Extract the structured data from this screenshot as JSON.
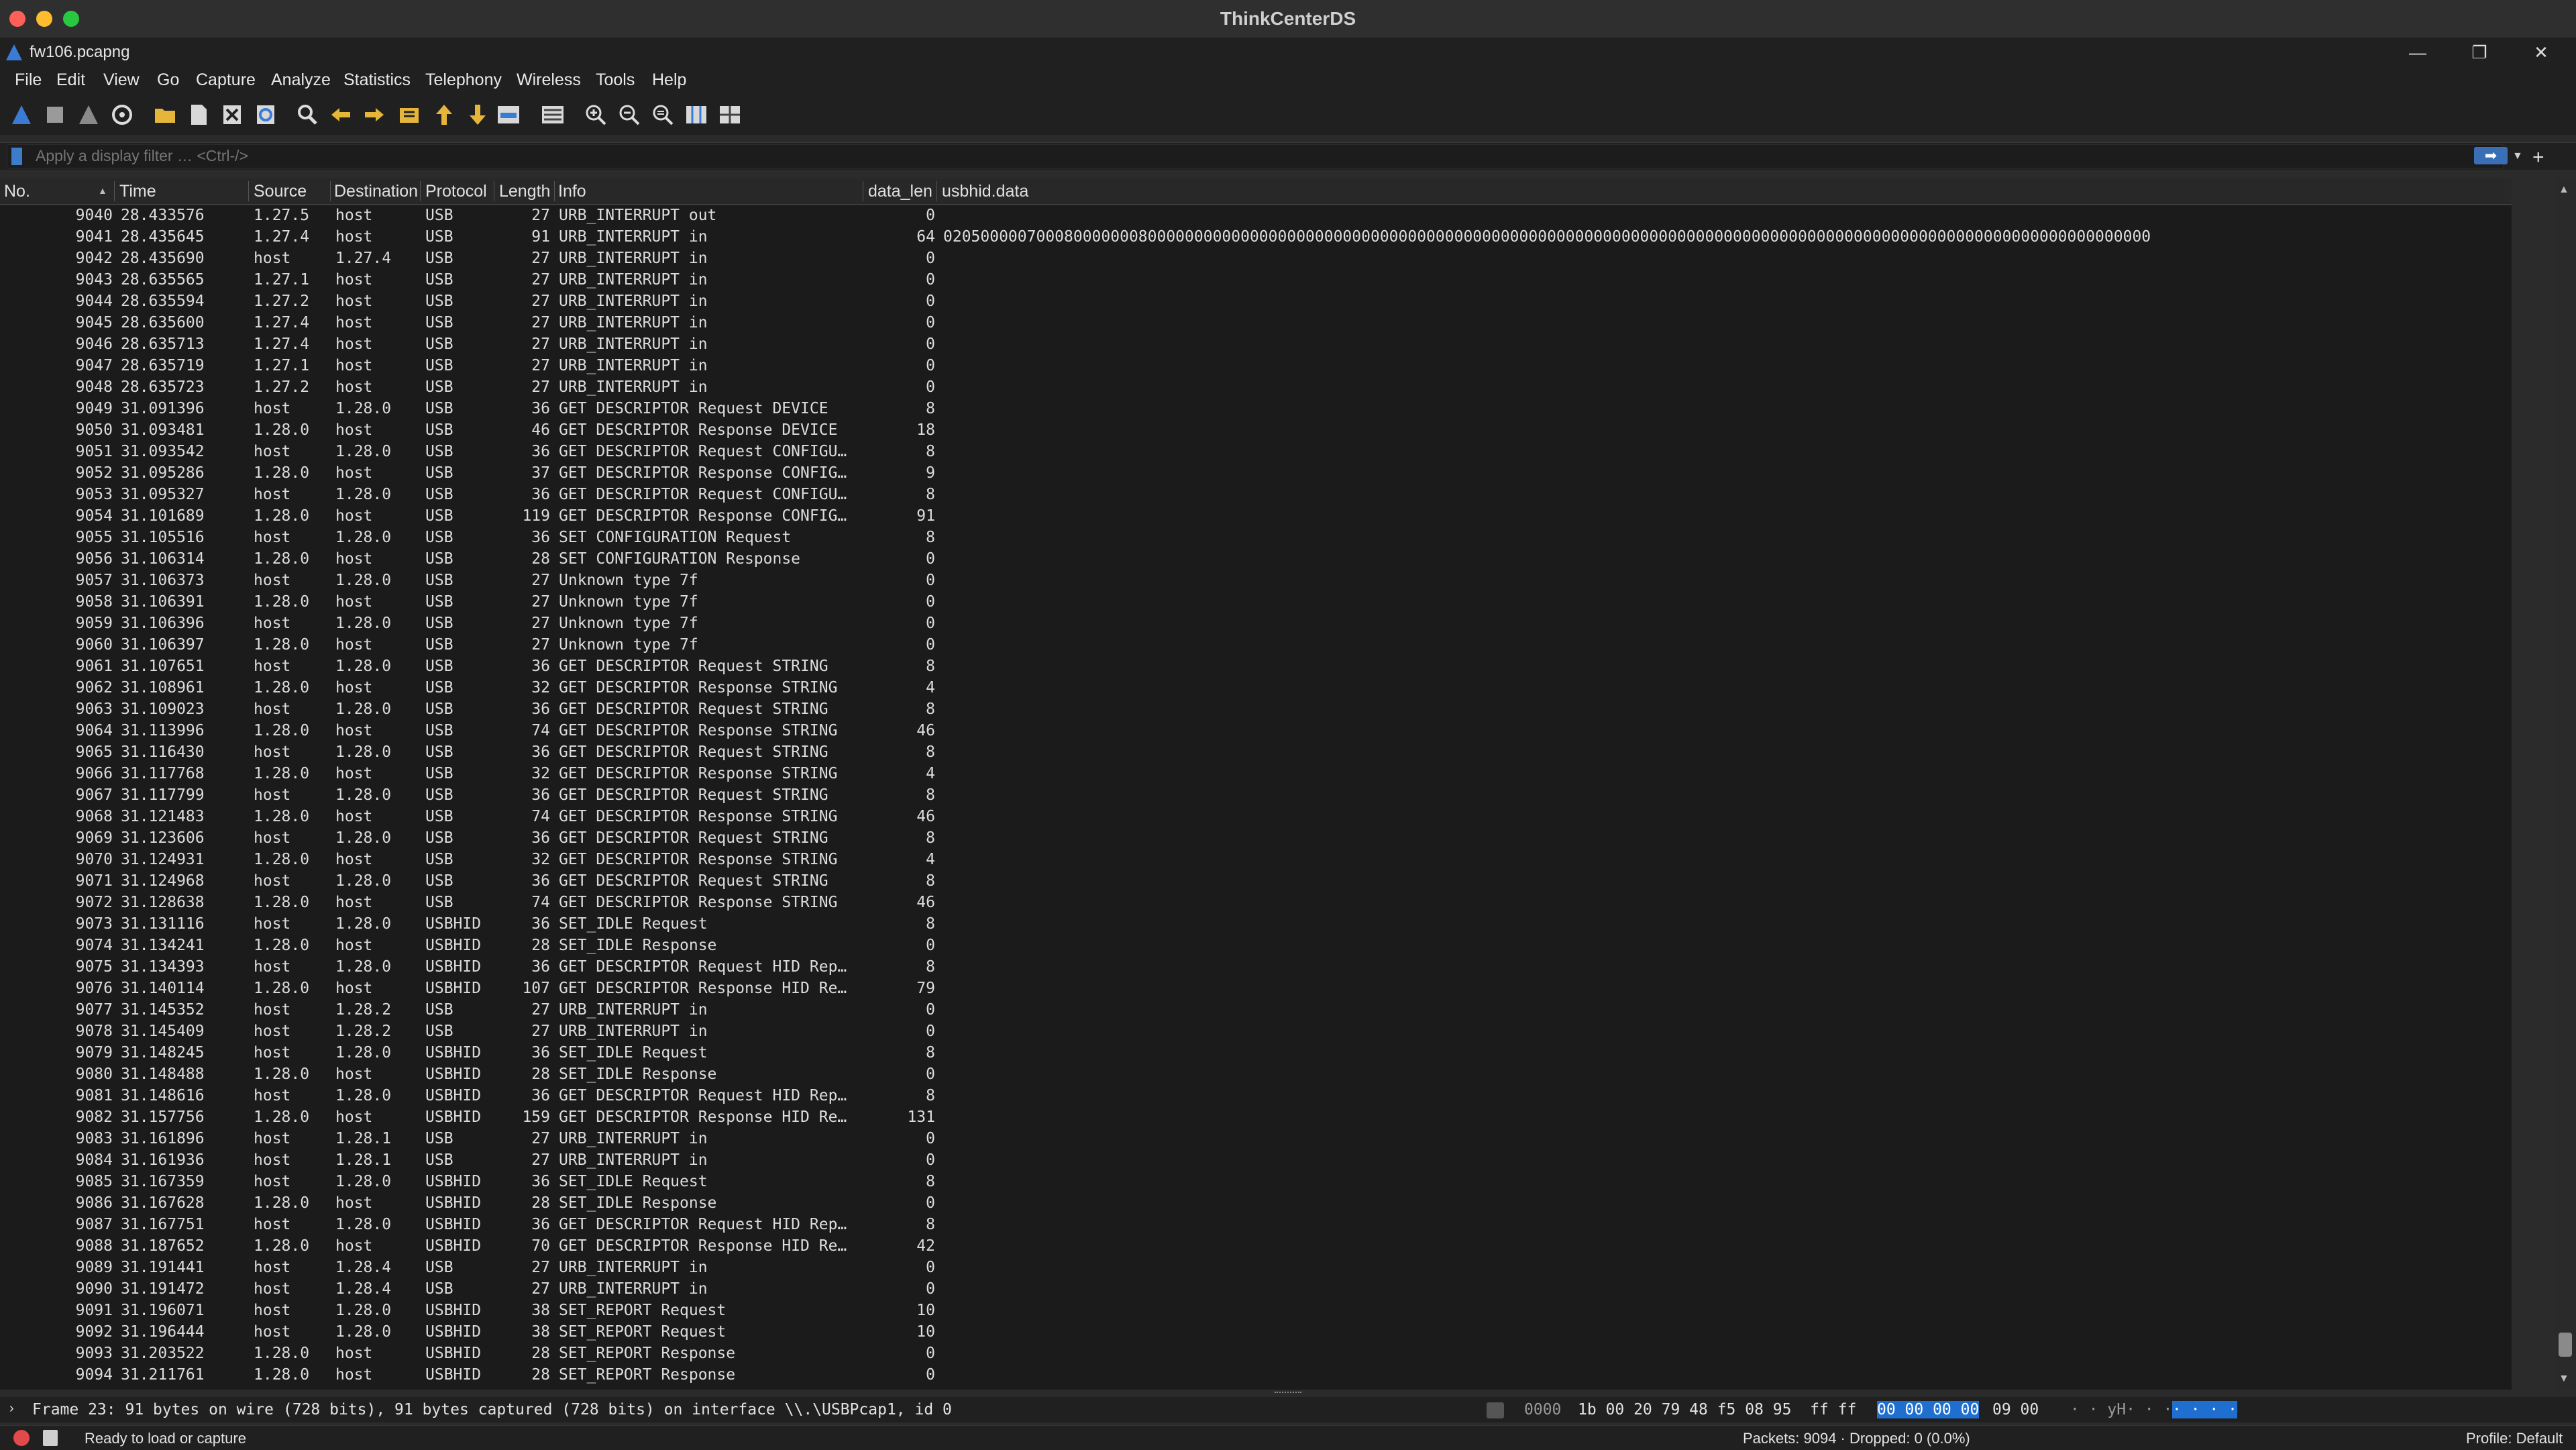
{
  "window": {
    "host_title": "ThinkCenterDS",
    "file_title": "fw106.pcapng"
  },
  "window_controls": {
    "minimize": "—",
    "restore": "❐",
    "close": "✕"
  },
  "menu": [
    {
      "label": "File"
    },
    {
      "label": "Edit"
    },
    {
      "label": "View"
    },
    {
      "label": "Go"
    },
    {
      "label": "Capture"
    },
    {
      "label": "Analyze"
    },
    {
      "label": "Statistics"
    },
    {
      "label": "Telephony"
    },
    {
      "label": "Wireless"
    },
    {
      "label": "Tools"
    },
    {
      "label": "Help"
    }
  ],
  "toolbar": [
    "start-capture",
    "stop-capture",
    "restart-capture",
    "capture-options",
    "open-file",
    "save-file",
    "close-file",
    "reload-file",
    "find-packet",
    "go-back",
    "go-forward",
    "go-to-packet",
    "go-first",
    "go-last",
    "autoscroll",
    "colorize",
    "zoom-in",
    "zoom-out",
    "normal-size",
    "resize-columns",
    "layout"
  ],
  "filter": {
    "placeholder": "Apply a display filter … <Ctrl-/>",
    "apply_label": "➡",
    "add_label": "+"
  },
  "columns": [
    "No.",
    "Time",
    "Source",
    "Destination",
    "Protocol",
    "Length",
    "Info",
    "data_len",
    "usbhid.data"
  ],
  "packets": [
    [
      "9040",
      "28.433576",
      "1.27.5",
      "host",
      "USB",
      "27",
      "URB_INTERRUPT out",
      "0",
      ""
    ],
    [
      "9041",
      "28.435645",
      "1.27.4",
      "host",
      "USB",
      "91",
      "URB_INTERRUPT in",
      "64",
      "0205000007000800000008000000000000000000000000000000000000000000000000000000000000000000000000000000000000000000000000000000000000"
    ],
    [
      "9042",
      "28.435690",
      "host",
      "1.27.4",
      "USB",
      "27",
      "URB_INTERRUPT in",
      "0",
      ""
    ],
    [
      "9043",
      "28.635565",
      "1.27.1",
      "host",
      "USB",
      "27",
      "URB_INTERRUPT in",
      "0",
      ""
    ],
    [
      "9044",
      "28.635594",
      "1.27.2",
      "host",
      "USB",
      "27",
      "URB_INTERRUPT in",
      "0",
      ""
    ],
    [
      "9045",
      "28.635600",
      "1.27.4",
      "host",
      "USB",
      "27",
      "URB_INTERRUPT in",
      "0",
      ""
    ],
    [
      "9046",
      "28.635713",
      "1.27.4",
      "host",
      "USB",
      "27",
      "URB_INTERRUPT in",
      "0",
      ""
    ],
    [
      "9047",
      "28.635719",
      "1.27.1",
      "host",
      "USB",
      "27",
      "URB_INTERRUPT in",
      "0",
      ""
    ],
    [
      "9048",
      "28.635723",
      "1.27.2",
      "host",
      "USB",
      "27",
      "URB_INTERRUPT in",
      "0",
      ""
    ],
    [
      "9049",
      "31.091396",
      "host",
      "1.28.0",
      "USB",
      "36",
      "GET DESCRIPTOR Request DEVICE",
      "8",
      ""
    ],
    [
      "9050",
      "31.093481",
      "1.28.0",
      "host",
      "USB",
      "46",
      "GET DESCRIPTOR Response DEVICE",
      "18",
      ""
    ],
    [
      "9051",
      "31.093542",
      "host",
      "1.28.0",
      "USB",
      "36",
      "GET DESCRIPTOR Request CONFIGU…",
      "8",
      ""
    ],
    [
      "9052",
      "31.095286",
      "1.28.0",
      "host",
      "USB",
      "37",
      "GET DESCRIPTOR Response CONFIG…",
      "9",
      ""
    ],
    [
      "9053",
      "31.095327",
      "host",
      "1.28.0",
      "USB",
      "36",
      "GET DESCRIPTOR Request CONFIGU…",
      "8",
      ""
    ],
    [
      "9054",
      "31.101689",
      "1.28.0",
      "host",
      "USB",
      "119",
      "GET DESCRIPTOR Response CONFIG…",
      "91",
      ""
    ],
    [
      "9055",
      "31.105516",
      "host",
      "1.28.0",
      "USB",
      "36",
      "SET CONFIGURATION Request",
      "8",
      ""
    ],
    [
      "9056",
      "31.106314",
      "1.28.0",
      "host",
      "USB",
      "28",
      "SET CONFIGURATION Response",
      "0",
      ""
    ],
    [
      "9057",
      "31.106373",
      "host",
      "1.28.0",
      "USB",
      "27",
      "Unknown type 7f",
      "0",
      ""
    ],
    [
      "9058",
      "31.106391",
      "1.28.0",
      "host",
      "USB",
      "27",
      "Unknown type 7f",
      "0",
      ""
    ],
    [
      "9059",
      "31.106396",
      "host",
      "1.28.0",
      "USB",
      "27",
      "Unknown type 7f",
      "0",
      ""
    ],
    [
      "9060",
      "31.106397",
      "1.28.0",
      "host",
      "USB",
      "27",
      "Unknown type 7f",
      "0",
      ""
    ],
    [
      "9061",
      "31.107651",
      "host",
      "1.28.0",
      "USB",
      "36",
      "GET DESCRIPTOR Request STRING",
      "8",
      ""
    ],
    [
      "9062",
      "31.108961",
      "1.28.0",
      "host",
      "USB",
      "32",
      "GET DESCRIPTOR Response STRING",
      "4",
      ""
    ],
    [
      "9063",
      "31.109023",
      "host",
      "1.28.0",
      "USB",
      "36",
      "GET DESCRIPTOR Request STRING",
      "8",
      ""
    ],
    [
      "9064",
      "31.113996",
      "1.28.0",
      "host",
      "USB",
      "74",
      "GET DESCRIPTOR Response STRING",
      "46",
      ""
    ],
    [
      "9065",
      "31.116430",
      "host",
      "1.28.0",
      "USB",
      "36",
      "GET DESCRIPTOR Request STRING",
      "8",
      ""
    ],
    [
      "9066",
      "31.117768",
      "1.28.0",
      "host",
      "USB",
      "32",
      "GET DESCRIPTOR Response STRING",
      "4",
      ""
    ],
    [
      "9067",
      "31.117799",
      "host",
      "1.28.0",
      "USB",
      "36",
      "GET DESCRIPTOR Request STRING",
      "8",
      ""
    ],
    [
      "9068",
      "31.121483",
      "1.28.0",
      "host",
      "USB",
      "74",
      "GET DESCRIPTOR Response STRING",
      "46",
      ""
    ],
    [
      "9069",
      "31.123606",
      "host",
      "1.28.0",
      "USB",
      "36",
      "GET DESCRIPTOR Request STRING",
      "8",
      ""
    ],
    [
      "9070",
      "31.124931",
      "1.28.0",
      "host",
      "USB",
      "32",
      "GET DESCRIPTOR Response STRING",
      "4",
      ""
    ],
    [
      "9071",
      "31.124968",
      "host",
      "1.28.0",
      "USB",
      "36",
      "GET DESCRIPTOR Request STRING",
      "8",
      ""
    ],
    [
      "9072",
      "31.128638",
      "1.28.0",
      "host",
      "USB",
      "74",
      "GET DESCRIPTOR Response STRING",
      "46",
      ""
    ],
    [
      "9073",
      "31.131116",
      "host",
      "1.28.0",
      "USBHID",
      "36",
      "SET_IDLE Request",
      "8",
      ""
    ],
    [
      "9074",
      "31.134241",
      "1.28.0",
      "host",
      "USBHID",
      "28",
      "SET_IDLE Response",
      "0",
      ""
    ],
    [
      "9075",
      "31.134393",
      "host",
      "1.28.0",
      "USBHID",
      "36",
      "GET DESCRIPTOR Request HID Rep…",
      "8",
      ""
    ],
    [
      "9076",
      "31.140114",
      "1.28.0",
      "host",
      "USBHID",
      "107",
      "GET DESCRIPTOR Response HID Re…",
      "79",
      ""
    ],
    [
      "9077",
      "31.145352",
      "host",
      "1.28.2",
      "USB",
      "27",
      "URB_INTERRUPT in",
      "0",
      ""
    ],
    [
      "9078",
      "31.145409",
      "host",
      "1.28.2",
      "USB",
      "27",
      "URB_INTERRUPT in",
      "0",
      ""
    ],
    [
      "9079",
      "31.148245",
      "host",
      "1.28.0",
      "USBHID",
      "36",
      "SET_IDLE Request",
      "8",
      ""
    ],
    [
      "9080",
      "31.148488",
      "1.28.0",
      "host",
      "USBHID",
      "28",
      "SET_IDLE Response",
      "0",
      ""
    ],
    [
      "9081",
      "31.148616",
      "host",
      "1.28.0",
      "USBHID",
      "36",
      "GET DESCRIPTOR Request HID Rep…",
      "8",
      ""
    ],
    [
      "9082",
      "31.157756",
      "1.28.0",
      "host",
      "USBHID",
      "159",
      "GET DESCRIPTOR Response HID Re…",
      "131",
      ""
    ],
    [
      "9083",
      "31.161896",
      "host",
      "1.28.1",
      "USB",
      "27",
      "URB_INTERRUPT in",
      "0",
      ""
    ],
    [
      "9084",
      "31.161936",
      "host",
      "1.28.1",
      "USB",
      "27",
      "URB_INTERRUPT in",
      "0",
      ""
    ],
    [
      "9085",
      "31.167359",
      "host",
      "1.28.0",
      "USBHID",
      "36",
      "SET_IDLE Request",
      "8",
      ""
    ],
    [
      "9086",
      "31.167628",
      "1.28.0",
      "host",
      "USBHID",
      "28",
      "SET_IDLE Response",
      "0",
      ""
    ],
    [
      "9087",
      "31.167751",
      "host",
      "1.28.0",
      "USBHID",
      "36",
      "GET DESCRIPTOR Request HID Rep…",
      "8",
      ""
    ],
    [
      "9088",
      "31.187652",
      "1.28.0",
      "host",
      "USBHID",
      "70",
      "GET DESCRIPTOR Response HID Re…",
      "42",
      ""
    ],
    [
      "9089",
      "31.191441",
      "host",
      "1.28.4",
      "USB",
      "27",
      "URB_INTERRUPT in",
      "0",
      ""
    ],
    [
      "9090",
      "31.191472",
      "host",
      "1.28.4",
      "USB",
      "27",
      "URB_INTERRUPT in",
      "0",
      ""
    ],
    [
      "9091",
      "31.196071",
      "host",
      "1.28.0",
      "USBHID",
      "38",
      "SET_REPORT Request",
      "10",
      ""
    ],
    [
      "9092",
      "31.196444",
      "host",
      "1.28.0",
      "USBHID",
      "38",
      "SET_REPORT Request",
      "10",
      ""
    ],
    [
      "9093",
      "31.203522",
      "1.28.0",
      "host",
      "USBHID",
      "28",
      "SET_REPORT Response",
      "0",
      ""
    ],
    [
      "9094",
      "31.211761",
      "1.28.0",
      "host",
      "USBHID",
      "28",
      "SET_REPORT Response",
      "0",
      ""
    ]
  ],
  "detail": {
    "expander": "›",
    "frame_text": "Frame 23: 91 bytes on wire (728 bits), 91 bytes captured (728 bits) on interface \\\\.\\USBPcap1, id 0"
  },
  "hex": {
    "offset": "0000",
    "bytes": "1b 00 20 79 48 f5 08 95  ff ff",
    "selected": "00 00 00 00",
    "tail": "09 00",
    "ascii": "· · yH· · ·",
    "ascii_selected": "· · · ·"
  },
  "status": {
    "ready": "Ready to load or capture",
    "packets": "Packets: 9094 · Dropped: 0 (0.0%)",
    "profile": "Profile: Default"
  },
  "colors": {
    "accent": "#1f6fd0",
    "background": "#1b1b1b"
  }
}
